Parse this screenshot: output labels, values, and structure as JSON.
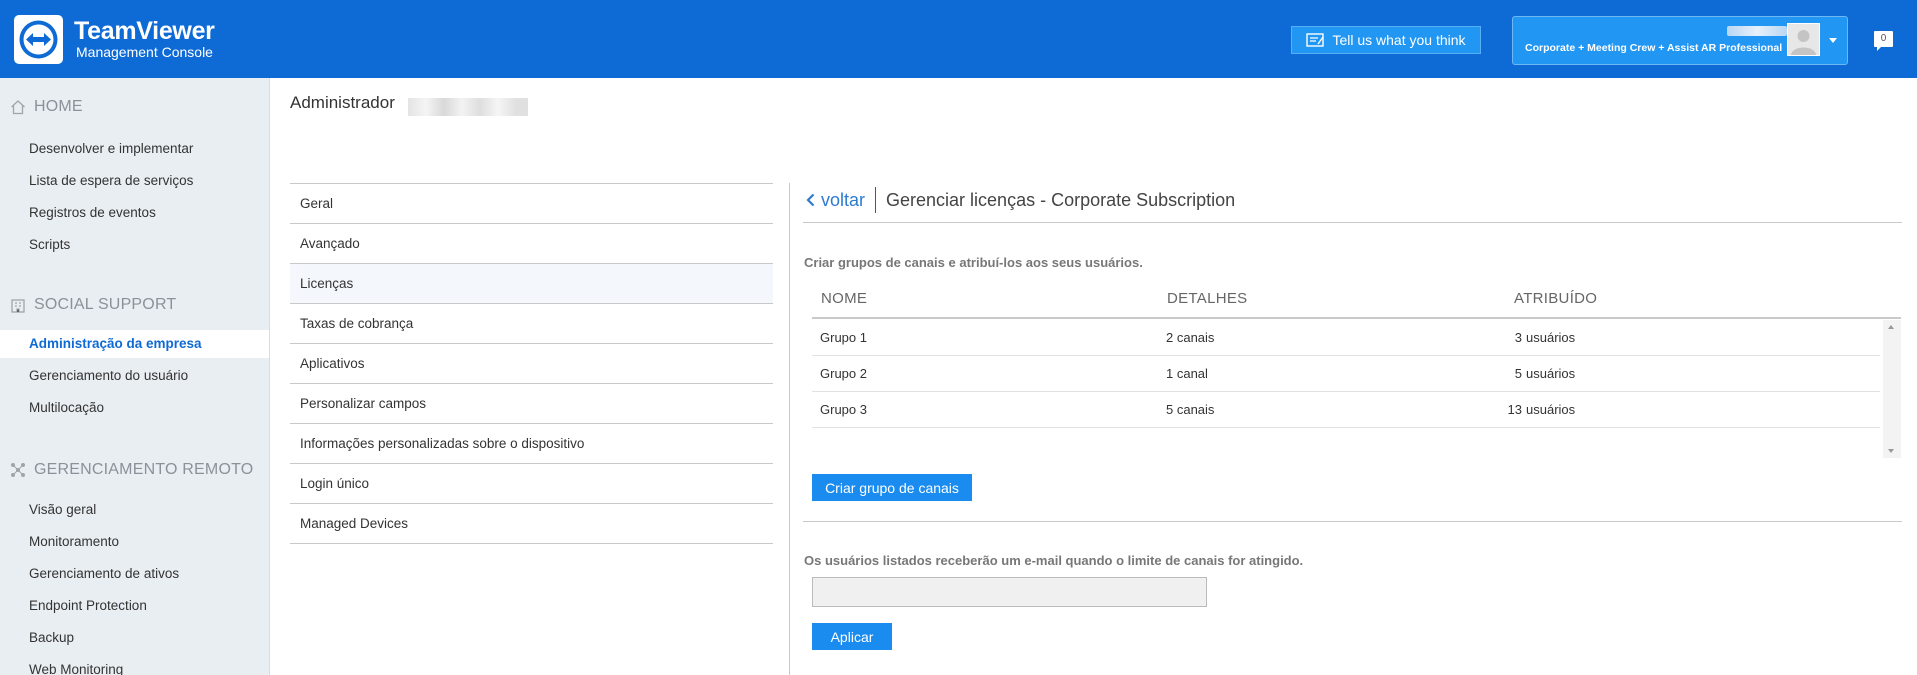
{
  "header": {
    "brand": "TeamViewer",
    "brand_sub": "Management Console",
    "feedback_label": "Tell us what you think",
    "account_plan": "Corporate + Meeting Crew + Assist AR Professional",
    "notification_count": "0",
    "bg_color": "#0e6ad4"
  },
  "sidebar": {
    "sections": [
      {
        "title": "HOME",
        "icon": "home-icon"
      },
      {
        "title": "SOCIAL SUPPORT",
        "icon": "building-icon"
      },
      {
        "title": "GERENCIAMENTO REMOTO",
        "icon": "network-icon"
      }
    ],
    "items": [
      {
        "label": "Desenvolver e implementar"
      },
      {
        "label": "Lista de espera de serviços"
      },
      {
        "label": "Registros de eventos"
      },
      {
        "label": "Scripts"
      },
      {
        "label": "Administração da empresa",
        "active": true
      },
      {
        "label": "Gerenciamento do usuário"
      },
      {
        "label": "Multilocação"
      },
      {
        "label": "Visão geral"
      },
      {
        "label": "Monitoramento"
      },
      {
        "label": "Gerenciamento de ativos"
      },
      {
        "label": "Endpoint Protection"
      },
      {
        "label": "Backup"
      },
      {
        "label": "Web Monitoring"
      }
    ]
  },
  "main": {
    "title": "Administrador",
    "nav": [
      {
        "label": "Geral"
      },
      {
        "label": "Avançado"
      },
      {
        "label": "Licenças",
        "active": true
      },
      {
        "label": "Taxas de cobrança"
      },
      {
        "label": "Aplicativos"
      },
      {
        "label": "Personalizar campos"
      },
      {
        "label": "Informações personalizadas sobre o dispositivo"
      },
      {
        "label": "Login único"
      },
      {
        "label": "Managed Devices"
      }
    ],
    "panel": {
      "back_label": "voltar",
      "title": "Gerenciar licenças - Corporate Subscription",
      "description": "Criar grupos de canais e atribuí-los aos seus usuários.",
      "columns": [
        "NOME",
        "DETALHES",
        "ATRIBUÍDO"
      ],
      "rows": [
        {
          "name": "Grupo 1",
          "details": "2 canais",
          "assigned_count": "3",
          "assigned_unit": "usuários"
        },
        {
          "name": "Grupo 2",
          "details": "1 canal",
          "assigned_count": "5",
          "assigned_unit": "usuários"
        },
        {
          "name": "Grupo 3",
          "details": "5 canais",
          "assigned_count": "13",
          "assigned_unit": "usuários"
        }
      ],
      "create_button": "Criar grupo de canais",
      "email_description": "Os usuários listados receberão um e-mail quando o limite de canais for atingido.",
      "email_value": "",
      "apply_button": "Aplicar"
    }
  }
}
